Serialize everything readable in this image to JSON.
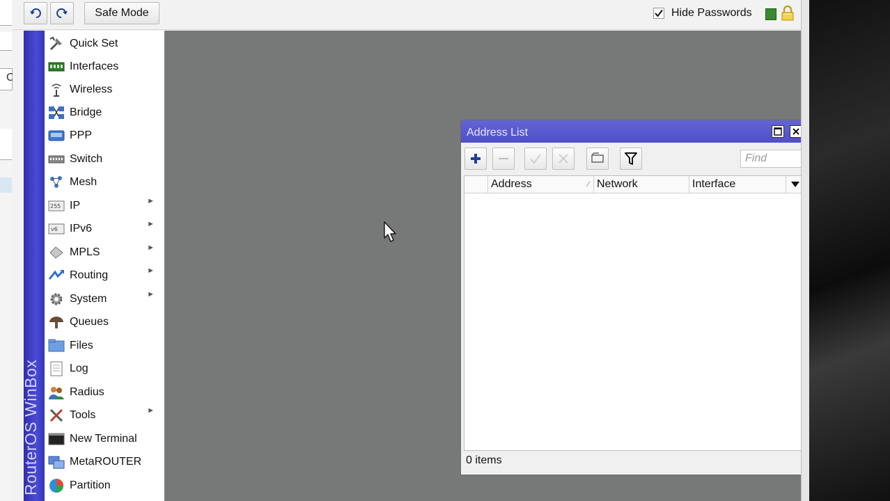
{
  "toolbar": {
    "safe_mode_label": "Safe Mode",
    "hide_passwords_label": "Hide Passwords",
    "hide_passwords_checked": true,
    "undo_icon": "undo-icon",
    "redo_icon": "redo-icon",
    "status_color": "#3a8a2e"
  },
  "left_window": {
    "partial_text": "C"
  },
  "sidebar": {
    "brand": "RouterOS WinBox",
    "brand_color": "#3b3bc0",
    "items": [
      {
        "label": "Quick Set",
        "icon": "quick-set-icon",
        "submenu": false
      },
      {
        "label": "Interfaces",
        "icon": "interfaces-icon",
        "submenu": false
      },
      {
        "label": "Wireless",
        "icon": "wireless-icon",
        "submenu": false
      },
      {
        "label": "Bridge",
        "icon": "bridge-icon",
        "submenu": false
      },
      {
        "label": "PPP",
        "icon": "ppp-icon",
        "submenu": false
      },
      {
        "label": "Switch",
        "icon": "switch-icon",
        "submenu": false
      },
      {
        "label": "Mesh",
        "icon": "mesh-icon",
        "submenu": false
      },
      {
        "label": "IP",
        "icon": "ip-icon",
        "submenu": true
      },
      {
        "label": "IPv6",
        "icon": "ipv6-icon",
        "submenu": true
      },
      {
        "label": "MPLS",
        "icon": "mpls-icon",
        "submenu": true
      },
      {
        "label": "Routing",
        "icon": "routing-icon",
        "submenu": true
      },
      {
        "label": "System",
        "icon": "system-icon",
        "submenu": true
      },
      {
        "label": "Queues",
        "icon": "queues-icon",
        "submenu": false
      },
      {
        "label": "Files",
        "icon": "files-icon",
        "submenu": false
      },
      {
        "label": "Log",
        "icon": "log-icon",
        "submenu": false
      },
      {
        "label": "Radius",
        "icon": "radius-icon",
        "submenu": false
      },
      {
        "label": "Tools",
        "icon": "tools-icon",
        "submenu": true
      },
      {
        "label": "New Terminal",
        "icon": "terminal-icon",
        "submenu": false
      },
      {
        "label": "MetaROUTER",
        "icon": "metarouter-icon",
        "submenu": false
      },
      {
        "label": "Partition",
        "icon": "partition-icon",
        "submenu": false
      }
    ]
  },
  "address_list": {
    "title": "Address List",
    "find_placeholder": "Find",
    "columns": [
      "Address",
      "Network",
      "Interface"
    ],
    "rows": [],
    "status": "0 items",
    "title_color": "#5757cc"
  }
}
